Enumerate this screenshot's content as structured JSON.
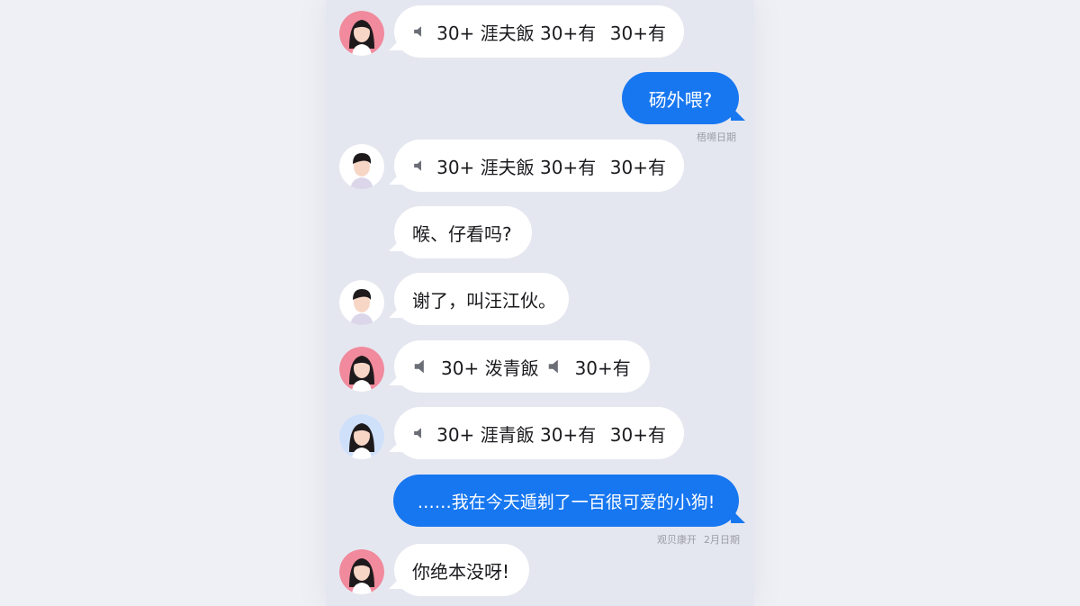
{
  "messages": [
    {
      "voice_a": "30+ 涯夫飯 30+有",
      "voice_b": "30+有"
    },
    {
      "text": "砀外喂?",
      "time": "梧嗍日期"
    },
    {
      "voice_a": "30+ 涯夫飯 30+有",
      "voice_b": "30+有"
    },
    {
      "text": "喉、仔看吗?"
    },
    {
      "text": "谢了，叫汪江伙。"
    },
    {
      "voice_a": "30+ 泼青飯",
      "voice_b": "30+有"
    },
    {
      "voice_a": "30+ 涯青飯 30+有",
      "voice_b": "30+有"
    },
    {
      "text": "……我在今天遁剃了一百很可爱的小狗!",
      "time_a": "观贝康开",
      "time_b": "2月日期"
    },
    {
      "text": "你绝本没呀!"
    }
  ],
  "colors": {
    "outgoing_bubble": "#1777f0",
    "incoming_bubble": "#ffffff",
    "avatar_pink": "#f08a9c",
    "avatar_blue": "#cfe0fa"
  },
  "icons": [
    "speaker-icon",
    "avatar-female",
    "avatar-male"
  ]
}
